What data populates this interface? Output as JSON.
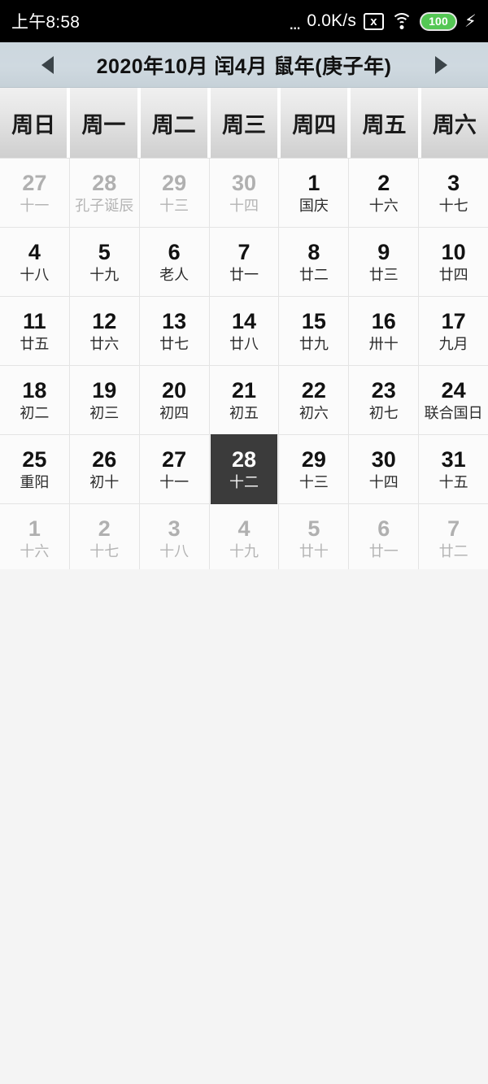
{
  "statusbar": {
    "time": "上午8:58",
    "dots": "...",
    "network_speed": "0.0K/s",
    "sim_icon_label": "x",
    "wifi_icon": "wifi-icon",
    "battery_level": "100",
    "charging_icon": "⚡"
  },
  "titlebar": {
    "prev_label": "◀",
    "next_label": "▶",
    "title": "2020年10月 闰4月 鼠年(庚子年)"
  },
  "weekdays": [
    "周日",
    "周一",
    "周二",
    "周三",
    "周四",
    "周五",
    "周六"
  ],
  "calendar": {
    "selected_day": "28",
    "selected_color": "#3b3b3b",
    "rows": [
      [
        {
          "num": "27",
          "lunar": "十一",
          "muted": true,
          "selected": false
        },
        {
          "num": "28",
          "lunar": "孔子诞辰",
          "muted": true,
          "selected": false
        },
        {
          "num": "29",
          "lunar": "十三",
          "muted": true,
          "selected": false
        },
        {
          "num": "30",
          "lunar": "十四",
          "muted": true,
          "selected": false
        },
        {
          "num": "1",
          "lunar": "国庆",
          "muted": false,
          "selected": false
        },
        {
          "num": "2",
          "lunar": "十六",
          "muted": false,
          "selected": false
        },
        {
          "num": "3",
          "lunar": "十七",
          "muted": false,
          "selected": false
        }
      ],
      [
        {
          "num": "4",
          "lunar": "十八",
          "muted": false,
          "selected": false
        },
        {
          "num": "5",
          "lunar": "十九",
          "muted": false,
          "selected": false
        },
        {
          "num": "6",
          "lunar": "老人",
          "muted": false,
          "selected": false
        },
        {
          "num": "7",
          "lunar": "廿一",
          "muted": false,
          "selected": false
        },
        {
          "num": "8",
          "lunar": "廿二",
          "muted": false,
          "selected": false
        },
        {
          "num": "9",
          "lunar": "廿三",
          "muted": false,
          "selected": false
        },
        {
          "num": "10",
          "lunar": "廿四",
          "muted": false,
          "selected": false
        }
      ],
      [
        {
          "num": "11",
          "lunar": "廿五",
          "muted": false,
          "selected": false
        },
        {
          "num": "12",
          "lunar": "廿六",
          "muted": false,
          "selected": false
        },
        {
          "num": "13",
          "lunar": "廿七",
          "muted": false,
          "selected": false
        },
        {
          "num": "14",
          "lunar": "廿八",
          "muted": false,
          "selected": false
        },
        {
          "num": "15",
          "lunar": "廿九",
          "muted": false,
          "selected": false
        },
        {
          "num": "16",
          "lunar": "卅十",
          "muted": false,
          "selected": false
        },
        {
          "num": "17",
          "lunar": "九月",
          "muted": false,
          "selected": false
        }
      ],
      [
        {
          "num": "18",
          "lunar": "初二",
          "muted": false,
          "selected": false
        },
        {
          "num": "19",
          "lunar": "初三",
          "muted": false,
          "selected": false
        },
        {
          "num": "20",
          "lunar": "初四",
          "muted": false,
          "selected": false
        },
        {
          "num": "21",
          "lunar": "初五",
          "muted": false,
          "selected": false
        },
        {
          "num": "22",
          "lunar": "初六",
          "muted": false,
          "selected": false
        },
        {
          "num": "23",
          "lunar": "初七",
          "muted": false,
          "selected": false
        },
        {
          "num": "24",
          "lunar": "联合国日",
          "muted": false,
          "selected": false
        }
      ],
      [
        {
          "num": "25",
          "lunar": "重阳",
          "muted": false,
          "selected": false
        },
        {
          "num": "26",
          "lunar": "初十",
          "muted": false,
          "selected": false
        },
        {
          "num": "27",
          "lunar": "十一",
          "muted": false,
          "selected": false
        },
        {
          "num": "28",
          "lunar": "十二",
          "muted": false,
          "selected": true
        },
        {
          "num": "29",
          "lunar": "十三",
          "muted": false,
          "selected": false
        },
        {
          "num": "30",
          "lunar": "十四",
          "muted": false,
          "selected": false
        },
        {
          "num": "31",
          "lunar": "十五",
          "muted": false,
          "selected": false
        }
      ],
      [
        {
          "num": "1",
          "lunar": "十六",
          "muted": true,
          "selected": false
        },
        {
          "num": "2",
          "lunar": "十七",
          "muted": true,
          "selected": false
        },
        {
          "num": "3",
          "lunar": "十八",
          "muted": true,
          "selected": false
        },
        {
          "num": "4",
          "lunar": "十九",
          "muted": true,
          "selected": false
        },
        {
          "num": "5",
          "lunar": "廿十",
          "muted": true,
          "selected": false
        },
        {
          "num": "6",
          "lunar": "廿一",
          "muted": true,
          "selected": false
        },
        {
          "num": "7",
          "lunar": "廿二",
          "muted": true,
          "selected": false
        }
      ]
    ]
  }
}
